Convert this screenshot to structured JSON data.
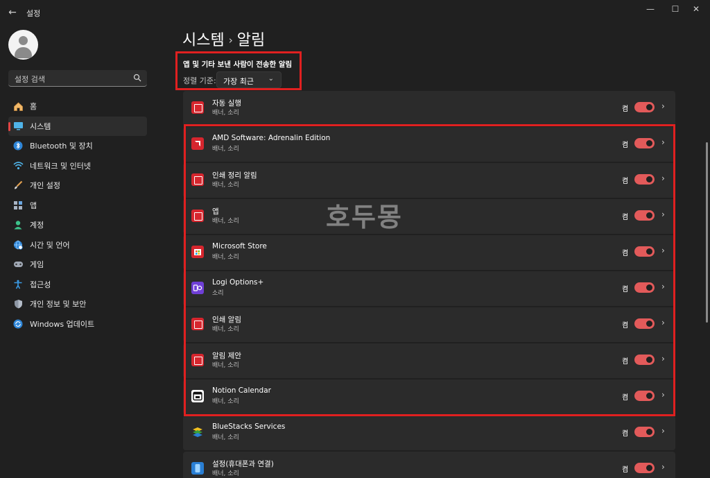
{
  "window": {
    "title": "설정",
    "back_icon": "back-arrow-icon",
    "minimize": "—",
    "maximize": "☐",
    "close": "✕"
  },
  "sidebar": {
    "search_placeholder": "설정 검색",
    "items": [
      {
        "label": "홈",
        "icon": "home-icon",
        "active": false
      },
      {
        "label": "시스템",
        "icon": "system-icon",
        "active": true
      },
      {
        "label": "Bluetooth 및 장치",
        "icon": "bluetooth-icon",
        "active": false
      },
      {
        "label": "네트워크 및 인터넷",
        "icon": "wifi-icon",
        "active": false
      },
      {
        "label": "개인 설정",
        "icon": "brush-icon",
        "active": false
      },
      {
        "label": "앱",
        "icon": "apps-icon",
        "active": false
      },
      {
        "label": "계정",
        "icon": "account-icon",
        "active": false
      },
      {
        "label": "시간 및 언어",
        "icon": "globe-icon",
        "active": false
      },
      {
        "label": "게임",
        "icon": "gamepad-icon",
        "active": false
      },
      {
        "label": "접근성",
        "icon": "accessibility-icon",
        "active": false
      },
      {
        "label": "개인 정보 및 보안",
        "icon": "shield-icon",
        "active": false
      },
      {
        "label": "Windows 업데이트",
        "icon": "update-icon",
        "active": false
      }
    ]
  },
  "breadcrumb": {
    "parent": "시스템",
    "separator": "›",
    "current": "알림"
  },
  "section": {
    "title": "앱 및 기타 보낸 사람이 전송한 알림",
    "sort_label": "정렬 기준:",
    "sort_value": "가장 최근"
  },
  "apps": [
    {
      "name": "자동 실행",
      "sub": "배너, 소리",
      "state": "켬",
      "icon": "autoplay-icon",
      "color": "#d6262e"
    },
    {
      "name": "AMD Software: Adrenalin Edition",
      "sub": "배너, 소리",
      "state": "켬",
      "icon": "amd-icon",
      "color": "#d6262e"
    },
    {
      "name": "인쇄 정리 알림",
      "sub": "배너, 소리",
      "state": "켬",
      "icon": "print-icon",
      "color": "#d6262e"
    },
    {
      "name": "앱",
      "sub": "배너, 소리",
      "state": "켬",
      "icon": "apps-icon",
      "color": "#d6262e"
    },
    {
      "name": "Microsoft Store",
      "sub": "배너, 소리",
      "state": "켬",
      "icon": "store-icon",
      "color": "#d6262e"
    },
    {
      "name": "Logi Options+",
      "sub": "소리",
      "state": "켬",
      "icon": "logi-icon",
      "color": "#6f3fd6"
    },
    {
      "name": "인쇄 알림",
      "sub": "배너, 소리",
      "state": "켬",
      "icon": "print-icon",
      "color": "#d6262e"
    },
    {
      "name": "알림 제안",
      "sub": "배너, 소리",
      "state": "켬",
      "icon": "suggest-icon",
      "color": "#d6262e"
    },
    {
      "name": "Notion Calendar",
      "sub": "배너, 소리",
      "state": "켬",
      "icon": "calendar-icon",
      "color": "#ffffff"
    },
    {
      "name": "BlueStacks Services",
      "sub": "배너, 소리",
      "state": "켬",
      "icon": "bluestacks-icon",
      "color": "#3aa03a"
    },
    {
      "name": "설정(휴대폰과 연결)",
      "sub": "배너, 소리",
      "state": "켬",
      "icon": "phone-link-icon",
      "color": "#2a7fd4"
    }
  ],
  "watermark": "호두몽",
  "colors": {
    "accent": "#e25a5a",
    "highlight": "#e02020",
    "background": "#202020",
    "card": "#2b2b2b"
  }
}
